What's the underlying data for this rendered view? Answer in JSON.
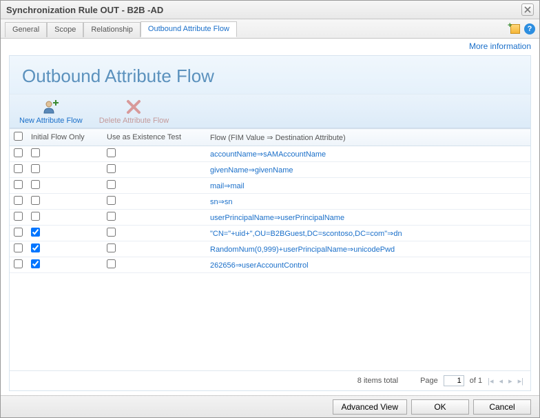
{
  "window": {
    "title": "Synchronization Rule OUT - B2B -AD"
  },
  "tabs": {
    "items": [
      {
        "label": "General"
      },
      {
        "label": "Scope"
      },
      {
        "label": "Relationship"
      },
      {
        "label": "Outbound Attribute Flow"
      }
    ],
    "activeIndex": 3
  },
  "links": {
    "more_info": "More information"
  },
  "panel": {
    "heading": "Outbound Attribute Flow"
  },
  "toolbar": {
    "new_flow": "New Attribute Flow",
    "delete_flow": "Delete Attribute Flow"
  },
  "columns": {
    "initial_flow_only": "Initial Flow Only",
    "use_as_existence_test": "Use as Existence Test",
    "flow": "Flow (FIM Value ⇒ Destination Attribute)"
  },
  "rows": [
    {
      "selected": false,
      "initialFlowOnly": false,
      "existenceTest": false,
      "flow": "accountName⇒sAMAccountName"
    },
    {
      "selected": false,
      "initialFlowOnly": false,
      "existenceTest": false,
      "flow": "givenName⇒givenName"
    },
    {
      "selected": false,
      "initialFlowOnly": false,
      "existenceTest": false,
      "flow": "mail⇒mail"
    },
    {
      "selected": false,
      "initialFlowOnly": false,
      "existenceTest": false,
      "flow": "sn⇒sn"
    },
    {
      "selected": false,
      "initialFlowOnly": false,
      "existenceTest": false,
      "flow": "userPrincipalName⇒userPrincipalName"
    },
    {
      "selected": false,
      "initialFlowOnly": true,
      "existenceTest": false,
      "flow": "\"CN=\"+uid+\",OU=B2BGuest,DC=scontoso,DC=com\"⇒dn"
    },
    {
      "selected": false,
      "initialFlowOnly": true,
      "existenceTest": false,
      "flow": "RandomNum(0,999)+userPrincipalName⇒unicodePwd"
    },
    {
      "selected": false,
      "initialFlowOnly": true,
      "existenceTest": false,
      "flow": "262656⇒userAccountControl"
    }
  ],
  "pager": {
    "total_label": "8 items total",
    "page_label": "Page",
    "page_value": "1",
    "of_label": "of 1"
  },
  "footer": {
    "advanced": "Advanced View",
    "ok": "OK",
    "cancel": "Cancel"
  }
}
